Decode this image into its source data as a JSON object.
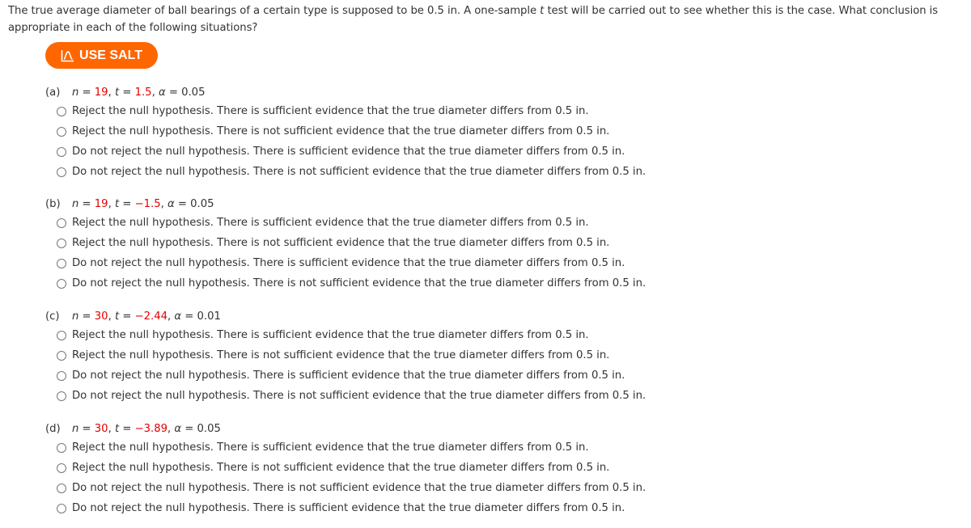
{
  "intro": {
    "before": "The true average diameter of ball bearings of a certain type is supposed to be 0.5 in. A one-sample ",
    "t": "t",
    "after": " test will be carried out to see whether this is the case. What conclusion is appropriate in each of the following situations?"
  },
  "salt_button": {
    "label": "USE SALT",
    "icon": "salt-chart-icon",
    "color": "#ff6600"
  },
  "parts": [
    {
      "label": "(a)",
      "n": "19",
      "t": "1.5",
      "alpha": "0.05",
      "options": [
        "Reject the null hypothesis. There is sufficient evidence that the true diameter differs from 0.5 in.",
        "Reject the null hypothesis. There is not sufficient evidence that the true diameter differs from 0.5 in.",
        "Do not reject the null hypothesis. There is sufficient evidence that the true diameter differs from 0.5 in.",
        "Do not reject the null hypothesis. There is not sufficient evidence that the true diameter differs from 0.5 in."
      ]
    },
    {
      "label": "(b)",
      "n": "19",
      "t": "−1.5",
      "alpha": "0.05",
      "options": [
        "Reject the null hypothesis. There is sufficient evidence that the true diameter differs from 0.5 in.",
        "Reject the null hypothesis. There is not sufficient evidence that the true diameter differs from 0.5 in.",
        "Do not reject the null hypothesis. There is sufficient evidence that the true diameter differs from 0.5 in.",
        "Do not reject the null hypothesis. There is not sufficient evidence that the true diameter differs from 0.5 in."
      ]
    },
    {
      "label": "(c)",
      "n": "30",
      "t": "−2.44",
      "alpha": "0.01",
      "options": [
        "Reject the null hypothesis. There is sufficient evidence that the true diameter differs from 0.5 in.",
        "Reject the null hypothesis. There is not sufficient evidence that the true diameter differs from 0.5 in.",
        "Do not reject the null hypothesis. There is sufficient evidence that the true diameter differs from 0.5 in.",
        "Do not reject the null hypothesis. There is not sufficient evidence that the true diameter differs from 0.5 in."
      ]
    },
    {
      "label": "(d)",
      "n": "30",
      "t": "−3.89",
      "alpha": "0.05",
      "options": [
        "Reject the null hypothesis. There is sufficient evidence that the true diameter differs from 0.5 in.",
        "Reject the null hypothesis. There is not sufficient evidence that the true diameter differs from 0.5 in.",
        "Do not reject the null hypothesis. There is not sufficient evidence that the true diameter differs from 0.5 in.",
        "Do not reject the null hypothesis. There is sufficient evidence that the true diameter differs from 0.5 in."
      ]
    }
  ],
  "symbols": {
    "n": "n",
    "t": "t",
    "alpha": "α",
    "eq": " = ",
    "sep": ", "
  }
}
